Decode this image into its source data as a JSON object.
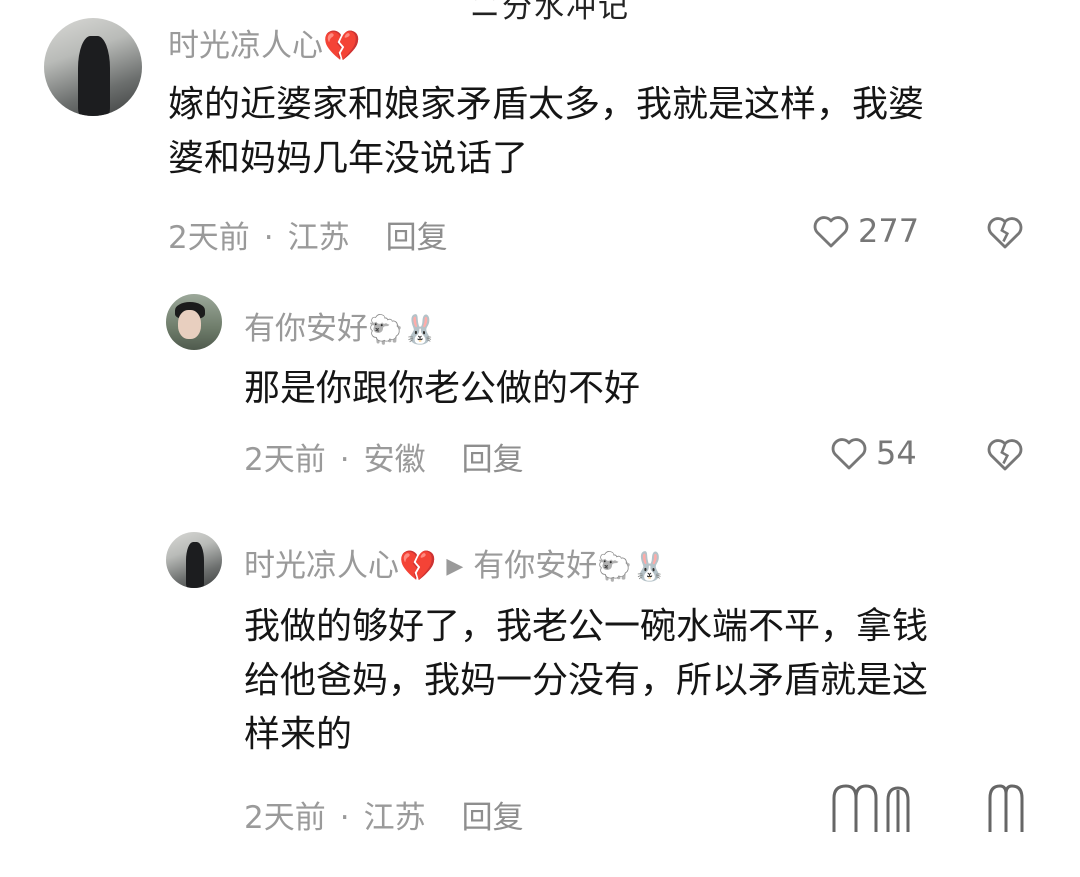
{
  "header": {
    "title_partial": "ニ分水冲记"
  },
  "comments": [
    {
      "username": "时光凉人心",
      "username_emoji": "💔",
      "text_line1": "嫁的近婆家和娘家矛盾太多，我就是这样，我婆",
      "text_line2": "婆和妈妈几年没说话了",
      "time": "2天前",
      "location": "江苏",
      "reply_label": "回复",
      "likes": "277"
    },
    {
      "username": "有你安好",
      "username_emoji": "🐑🐰",
      "text_line1": "那是你跟你老公做的不好",
      "time": "2天前",
      "location": "安徽",
      "reply_label": "回复",
      "likes": "54"
    },
    {
      "username": "时光凉人心",
      "username_emoji": "💔",
      "reply_to": "有你安好",
      "reply_to_emoji": "🐑🐰",
      "text_line1": "我做的够好了，我老公一碗水端不平，拿钱",
      "text_line2": "给他爸妈，我妈一分没有，所以矛盾就是这",
      "text_line3": "样来的",
      "time": "2天前",
      "location": "江苏",
      "reply_label": "回复"
    }
  ],
  "icons": {
    "like": "heart-outline-icon",
    "dislike": "broken-heart-outline-icon",
    "reply_arrow": "play-arrow-icon"
  }
}
